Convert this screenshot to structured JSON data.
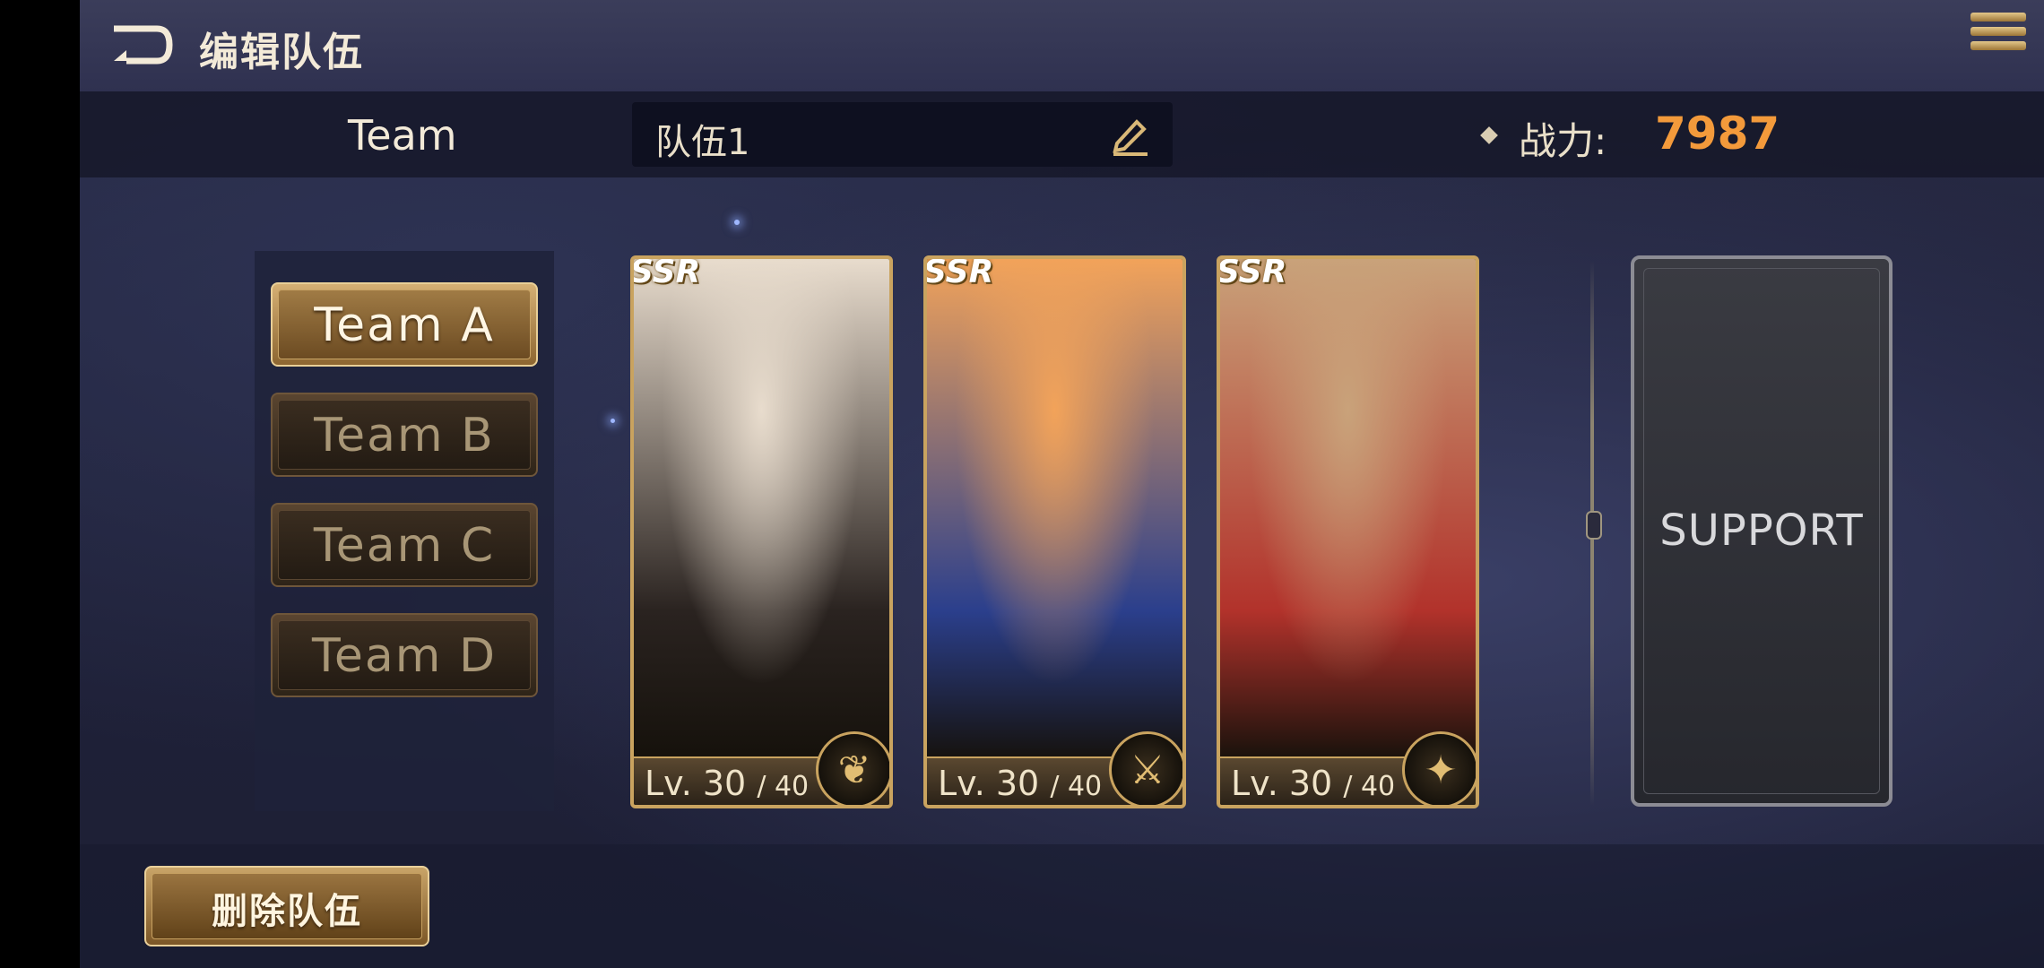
{
  "header": {
    "title": "编辑队伍"
  },
  "info_bar": {
    "team_label": "Team",
    "team_name": "队伍1",
    "power_label": "战力:",
    "power_value": "7987"
  },
  "team_list": [
    {
      "label": "Team  A",
      "active": true
    },
    {
      "label": "Team  B",
      "active": false
    },
    {
      "label": "Team  C",
      "active": false
    },
    {
      "label": "Team  D",
      "active": false
    }
  ],
  "characters": [
    {
      "rarity": "SSR",
      "level": "Lv. 30",
      "max_level": "/ 40",
      "class_icon": "wings-class-icon",
      "art_colors": [
        "#e8dccd",
        "#2a2320"
      ]
    },
    {
      "rarity": "SSR",
      "level": "Lv. 30",
      "max_level": "/ 40",
      "class_icon": "sword-class-icon",
      "art_colors": [
        "#f2a35a",
        "#2b3f8c"
      ]
    },
    {
      "rarity": "SSR",
      "level": "Lv. 30",
      "max_level": "/ 40",
      "class_icon": "pegasus-class-icon",
      "art_colors": [
        "#c9a27a",
        "#b2322b"
      ]
    }
  ],
  "support": {
    "label": "SUPPORT"
  },
  "actions": {
    "delete_label": "删除队伍"
  }
}
